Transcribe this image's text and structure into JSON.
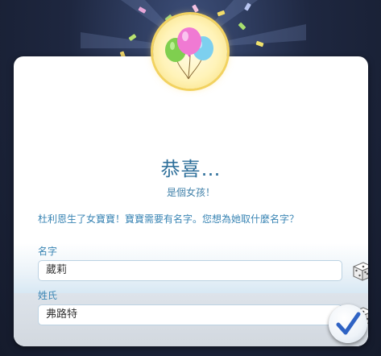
{
  "dialog": {
    "title": "恭喜…",
    "subtitle": "是個女孩！",
    "description": "杜利恩生了女寶寶！寶寶需要有名字。您想為她取什麼名字？"
  },
  "fields": {
    "first_name_label": "名字",
    "first_name_value": "葳莉",
    "last_name_label": "姓氏",
    "last_name_value": "弗路特"
  },
  "icons": {
    "medallion": "balloons-icon",
    "randomize": "dice-icon",
    "confirm": "checkmark-icon"
  },
  "colors": {
    "accent_blue": "#3a85b4",
    "title_blue": "#2e6f9a",
    "check_blue": "#2f63c4",
    "medallion_gold": "#f2d260"
  }
}
